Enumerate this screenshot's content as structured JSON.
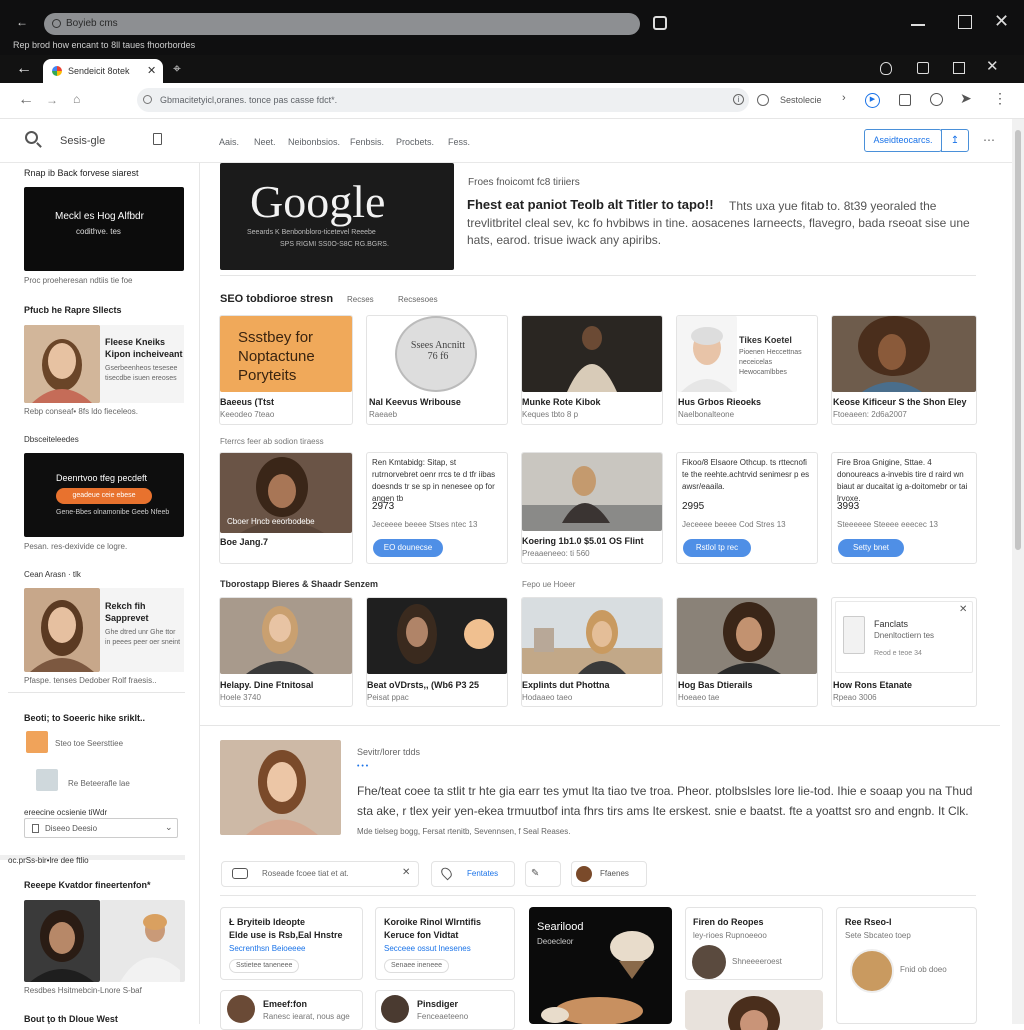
{
  "outer_window": {
    "url_text": "Boyieb cms",
    "subtitle": "Rep brod how encant to 8ll taues fhoorbordes"
  },
  "browser": {
    "tab_title": "Sendeicit 8otek",
    "address": "Gbmacitetyicl,oranes. tonce pas casse fdct*.",
    "toolbar_text": "Sestolecie"
  },
  "site_header": {
    "logo_text": "Sesis-gle",
    "nav": [
      "Aais.",
      "Neet.",
      "Neibonbsios.",
      "Fenbsis.",
      "Procbets.",
      "Fess."
    ],
    "cta_label": "Aseidteocarcs."
  },
  "left_sidebar": {
    "heading1": "Rnap ib Back forvese siarest",
    "banner1_line1": "Meckl es Hog Alfbdr",
    "banner1_line2": "codithve. tes",
    "note1": "Proc proeheresan ndtiis tie foe",
    "heading2": "Pfucb he Rapre Sllects",
    "profile1_title": "Fleese Kneiks",
    "profile1_line2": "Kipon incheiveant",
    "profile1_desc": "Gserbeenheos tesesee tisecdbe isuen ereoses",
    "profile1_note": "Rebp conseaf• 8fs ldo fieceleos.",
    "heading3": "Dbsceiteleedes",
    "banner2_title": "Deenrtvoo tfeg pecdeft",
    "banner2_button": "geadeue ceie ebese",
    "banner2_sub": "Gene-Bbes olnamonibe Geeb Nfeeb",
    "note2": "Pesan. res-dexivide ce logre.",
    "heading4": "Cean Arasn · tlk",
    "profile2_title": "Rekch fih",
    "profile2_line2": "Sapprevet",
    "profile2_desc": "Ghe dtred unr Ghe ttor in peees peer oer sneint",
    "note3": "Pfaspe. tenses  Dedober Rolf fraesis..",
    "heading5": "Beoti; to Soeeric hike sriklt..",
    "item1": "Steo toe Seersttiee",
    "item2": "Re Beteerafle lae",
    "heading6": "ereecine ocsienie tiWdr",
    "select_value": "Diseeo Deesio",
    "heading7": "oc.prSs-bir•lre dee ftlio",
    "heading8": "Reeepe Kvatdor fineertenfon*",
    "caption8": "Resdbes Hsitmebcin-Lnore S-baf",
    "heading9": "Bout ţo th Dloue West"
  },
  "hero": {
    "logo": "Google",
    "logo_sub1": "Seeards K Benbonbloro-ticetevel Reeebe",
    "logo_sub2": "SPS RIGMI SS0O-S8C RG.BGRS.",
    "kicker": "Froes fnoicomt fc8 tiriiers",
    "title": "Fhest eat paniot Teolb alt Titler to tapo!!",
    "body": "Thts uxa yue fitab to. 8t39 yeoraled the trevlitbritel cleal sev, kc fo hvbibws in tine. aosacenes Iarneects, flavegro, bada rseoat sise une hats, earod. trisue iwack any apiribs."
  },
  "seo_section": {
    "title": "SEO tobdioroe stresn",
    "tab1": "Recses",
    "tab2": "Recsesoes"
  },
  "row1": [
    {
      "title": "Baeeus (Ttst",
      "sub": "Keeodeo 7teao",
      "art": "Ssstbey for Noptactune Poryteits"
    },
    {
      "title": "Nal Keevus Wribouse",
      "sub": "Raeaeb",
      "art": "Ssees Ancnitt 76 f6"
    },
    {
      "title": "Munke Rote Kibok",
      "sub": "Keques tbto 8 p"
    },
    {
      "title": "Hus Grbos Rieoeks",
      "sub": "Naelbonalteone",
      "art_title": "Tikes Koetel",
      "art_body": "Pioenen Heccettnas neceicelas Hewocamlbbes"
    },
    {
      "title": "Keose Kificeur S the Shon Eley",
      "sub": "Ftoeaeen: 2d6a2007"
    }
  ],
  "row2_label": "Fterrcs feer ab sodion tiraess",
  "row2": [
    {
      "title": "Boe Jang.7",
      "overlay": "Cboer Hncb eeorbodebe"
    },
    {
      "text": "Ren Kmtabidg: Sitap, st rutrnorvebret oenr rrcs te d tfr iibas doesnds tr se sp in nenesee op for angen tb",
      "price": "2973",
      "sub": "Jeceeee beeee Stses ntec 13",
      "button": "EO dounecse"
    },
    {
      "title": "Koering 1b1.0 $5.01 OS Flint",
      "sub": "Preaaeneeo: ti 560"
    },
    {
      "text": "Fikoo/8 Elsaore Othcup. ts rttecnofi te the reehte.achtrvid senimesr p es awsr/eaaila.",
      "price": "2995",
      "sub": "Jeceeee beeee Cod Stres 13",
      "button": "Rstlol tp rec"
    },
    {
      "text": "Fire Broa Gnigine, Sttae. 4 donoureacs a-invebis tire d raird wn biaut ar ducaitat ig a-doitomebr or tai lrvoxe.",
      "price": "3993",
      "sub": "Steeeeee Steeee eeecec 13",
      "button": "Setty bnet"
    }
  ],
  "row3_label": "Tborostapp Bieres & Shaadr Senzem",
  "row3_label2": "Fepo ue Hoeer",
  "row3": [
    {
      "title": "Helapy. Dine Ftnitosal",
      "sub": "Hoele 3740"
    },
    {
      "title": "Beat oVDrsts,, (Wb6 P3 25",
      "sub": "Peisat ppac"
    },
    {
      "title": "Explints dut Phottna",
      "sub": "Hodaaeo taeo"
    },
    {
      "title": "Hog Bas Dtierails",
      "sub": "Hoeaeo tae"
    },
    {
      "title": "How Rons Etanate",
      "sub": "Rpeao 3006",
      "ad_line1": "Fanclats",
      "ad_line2": "Dnenltoctiern tes",
      "ad_line3": "Reod e teoe 34"
    }
  ],
  "feature": {
    "kicker": "Sevitr/lorer tdds",
    "dots": "• • •",
    "body": "Fhe/teat coee ta stlit tr hte gia earr tes ymut lta tiao tve troa. Pheor. ptolbslsles lore lie-tod. Ihie e soaap you na Thud sta ake, r tlex yeir yen-ekea trmuutbof inta fhrs tirs ams Ite erskest. snie e baatst. fte a yoattst sro and engnb. It Clk.",
    "meta": "Mde tielseg bogg,   Fersat rtenitb,   Sevennsen, f Seal Reases."
  },
  "filter_bar": {
    "search_placeholder": "Roseade fcoee tiat et at.",
    "tag": "Fentates",
    "user": "Ffaenes"
  },
  "bottom_cards": [
    {
      "title1": "Ł Bryiteib ldeopte",
      "title2": "Elde use is Rsb,Eal Hnstre",
      "link": "Secrenthsn Beioeeee",
      "tag": "Sstietee taneneee"
    },
    {
      "title1": "Koroike Rinol Wlrntifis",
      "title2": "Keruce fon Vidtat",
      "link": "Secceee ossut lnesenes",
      "tag": "Senaee ineneee"
    },
    {
      "title": "Searilood",
      "sub": "Deoecleor"
    },
    {
      "title": "Firen do Reopes",
      "sub": "ley-rioes Rupnoeeoo",
      "author": "Shneeeeroest"
    },
    {
      "title": "Ree Rseo-I",
      "sub": "Sete Sbcateo toep",
      "author": "Fnid ob doeo"
    }
  ],
  "bottom_row2": [
    {
      "title": "Emeef:fon",
      "sub": "Ranesc iearat, nous age"
    },
    {
      "title": "Pinsdiger",
      "sub": "Fenceaeteeno"
    }
  ]
}
